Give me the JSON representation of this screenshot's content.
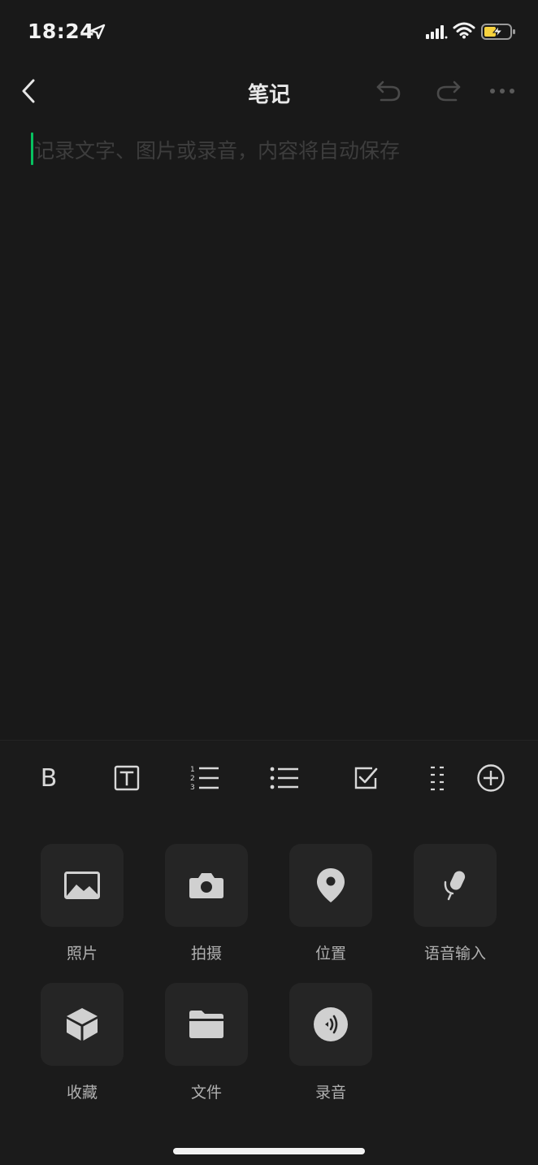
{
  "status_bar": {
    "time": "18:24",
    "icons": [
      "location-arrow-icon",
      "cellular-signal-icon",
      "wifi-icon",
      "battery-charging-icon"
    ],
    "battery_color": "#f7d23e"
  },
  "nav": {
    "title": "笔记",
    "icons": [
      "back-chevron-icon",
      "undo-icon",
      "redo-icon",
      "more-icon"
    ]
  },
  "editor": {
    "placeholder": "记录文字、图片或录音，内容将自动保存",
    "caret_color": "#07c160"
  },
  "format_toolbar": {
    "bold_label": "B",
    "tools": [
      "bold-icon",
      "text-style-icon",
      "numbered-list-icon",
      "bullet-list-icon",
      "checkbox-icon",
      "divider-icon",
      "add-circle-icon"
    ]
  },
  "attachments": [
    {
      "label": "照片",
      "icon": "photo-icon"
    },
    {
      "label": "拍摄",
      "icon": "camera-icon"
    },
    {
      "label": "位置",
      "icon": "location-pin-icon"
    },
    {
      "label": "语音输入",
      "icon": "microphone-icon"
    },
    {
      "label": "收藏",
      "icon": "favorites-cube-icon"
    },
    {
      "label": "文件",
      "icon": "folder-icon"
    },
    {
      "label": "录音",
      "icon": "audio-record-icon"
    }
  ],
  "colors": {
    "background": "#191919",
    "panel": "#1b1b1b",
    "tile": "#252525",
    "accent": "#07c160"
  }
}
